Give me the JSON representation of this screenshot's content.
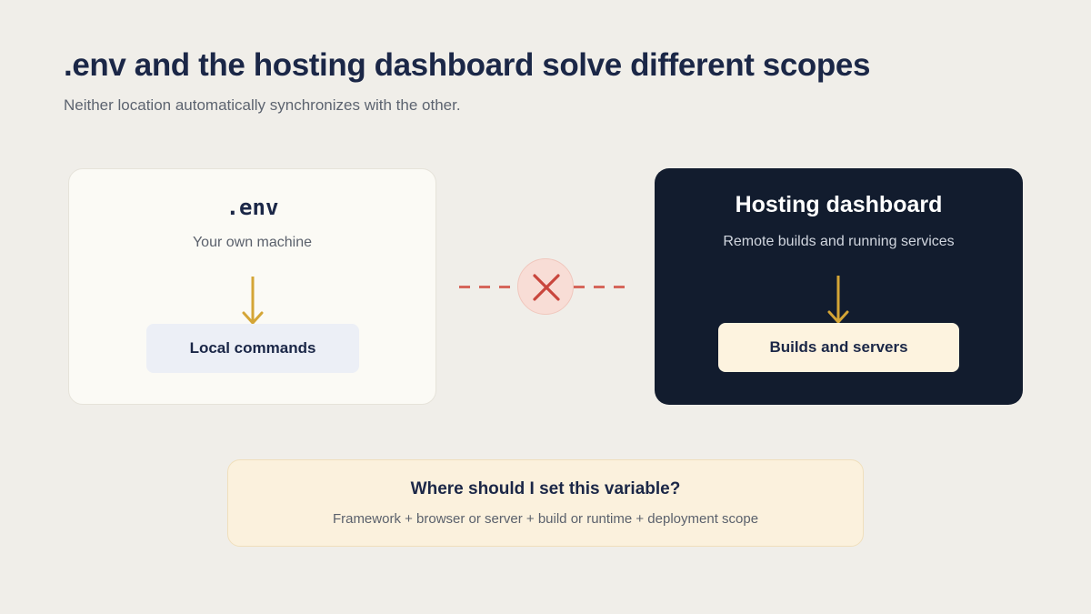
{
  "header": {
    "title": ".env and the hosting dashboard solve different scopes",
    "subtitle": "Neither location automatically synchronizes with the other."
  },
  "left_card": {
    "title": ".env",
    "subtitle": "Your own machine",
    "target": "Local commands",
    "icon": "arrow-down-icon"
  },
  "right_card": {
    "title": "Hosting dashboard",
    "subtitle": "Remote builds and running services",
    "target": "Builds and servers",
    "icon": "arrow-down-icon"
  },
  "connector": {
    "icon": "close-icon",
    "color": "#c9463d"
  },
  "question_box": {
    "title": "Where should I set this variable?",
    "subtitle": "Framework + browser or server + build or runtime + deployment scope"
  },
  "colors": {
    "background": "#f0eee9",
    "heading": "#1b2747",
    "dark_card": "#121c2e",
    "arrow": "#d4a536",
    "x_mark": "#c9463d",
    "dash": "#d6665b"
  }
}
